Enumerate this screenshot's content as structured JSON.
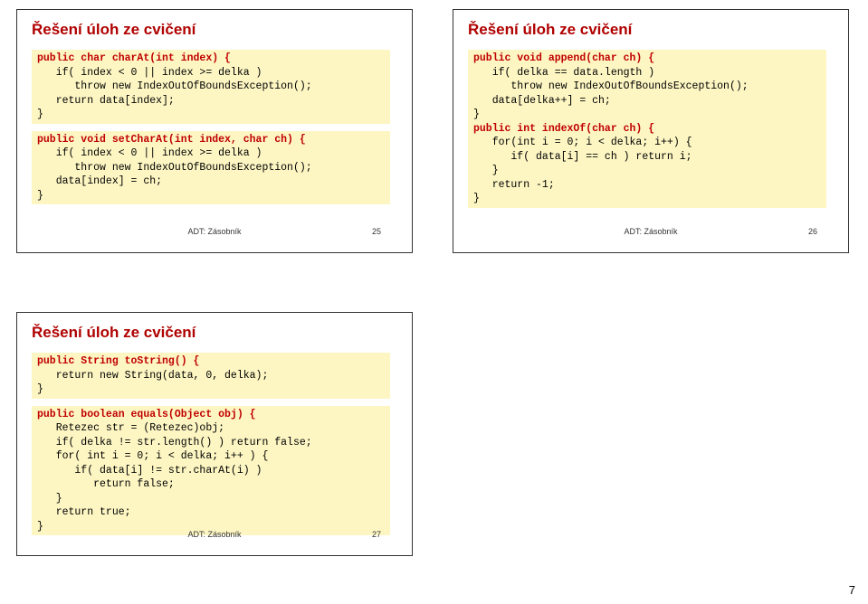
{
  "page_number": "7",
  "slides": {
    "s25": {
      "title": "Řešení úloh ze cvičení",
      "footer_label": "ADT: Zásobník",
      "footer_num": "25",
      "code1": {
        "l1": "public char charAt(int index) {",
        "l2": "   if( index < 0 || index >= delka )",
        "l3": "      throw new IndexOutOfBoundsException();",
        "l4": "   return data[index];",
        "l5": "}"
      },
      "code2": {
        "l1": "public void setCharAt(int index, char ch) {",
        "l2": "   if( index < 0 || index >= delka )",
        "l3": "      throw new IndexOutOfBoundsException();",
        "l4": "   data[index] = ch;",
        "l5": "}"
      }
    },
    "s26": {
      "title": "Řešení úloh ze cvičení",
      "footer_label": "ADT: Zásobník",
      "footer_num": "26",
      "code": {
        "l1": "public void append(char ch) {",
        "l2": "   if( delka == data.length )",
        "l3": "      throw new IndexOutOfBoundsException();",
        "l4": "   data[delka++] = ch;",
        "l5": "}",
        "l6": "public int indexOf(char ch) {",
        "l7": "   for(int i = 0; i < delka; i++) {",
        "l8": "      if( data[i] == ch ) return i;",
        "l9": "   }",
        "l10": "   return -1;",
        "l11": "}"
      }
    },
    "s27": {
      "title": "Řešení úloh ze cvičení",
      "footer_label": "ADT: Zásobník",
      "footer_num": "27",
      "code1": {
        "l1": "public String toString() {",
        "l2": "   return new String(data, 0, delka);",
        "l3": "}"
      },
      "code2": {
        "l1": "public boolean equals(Object obj) {",
        "l2": "   Retezec str = (Retezec)obj;",
        "l3": "   if( delka != str.length() ) return false;",
        "l4": "   for( int i = 0; i < delka; i++ ) {",
        "l5": "      if( data[i] != str.charAt(i) )",
        "l6": "         return false;",
        "l7": "   }",
        "l8": "   return true;",
        "l9": "}"
      }
    }
  }
}
